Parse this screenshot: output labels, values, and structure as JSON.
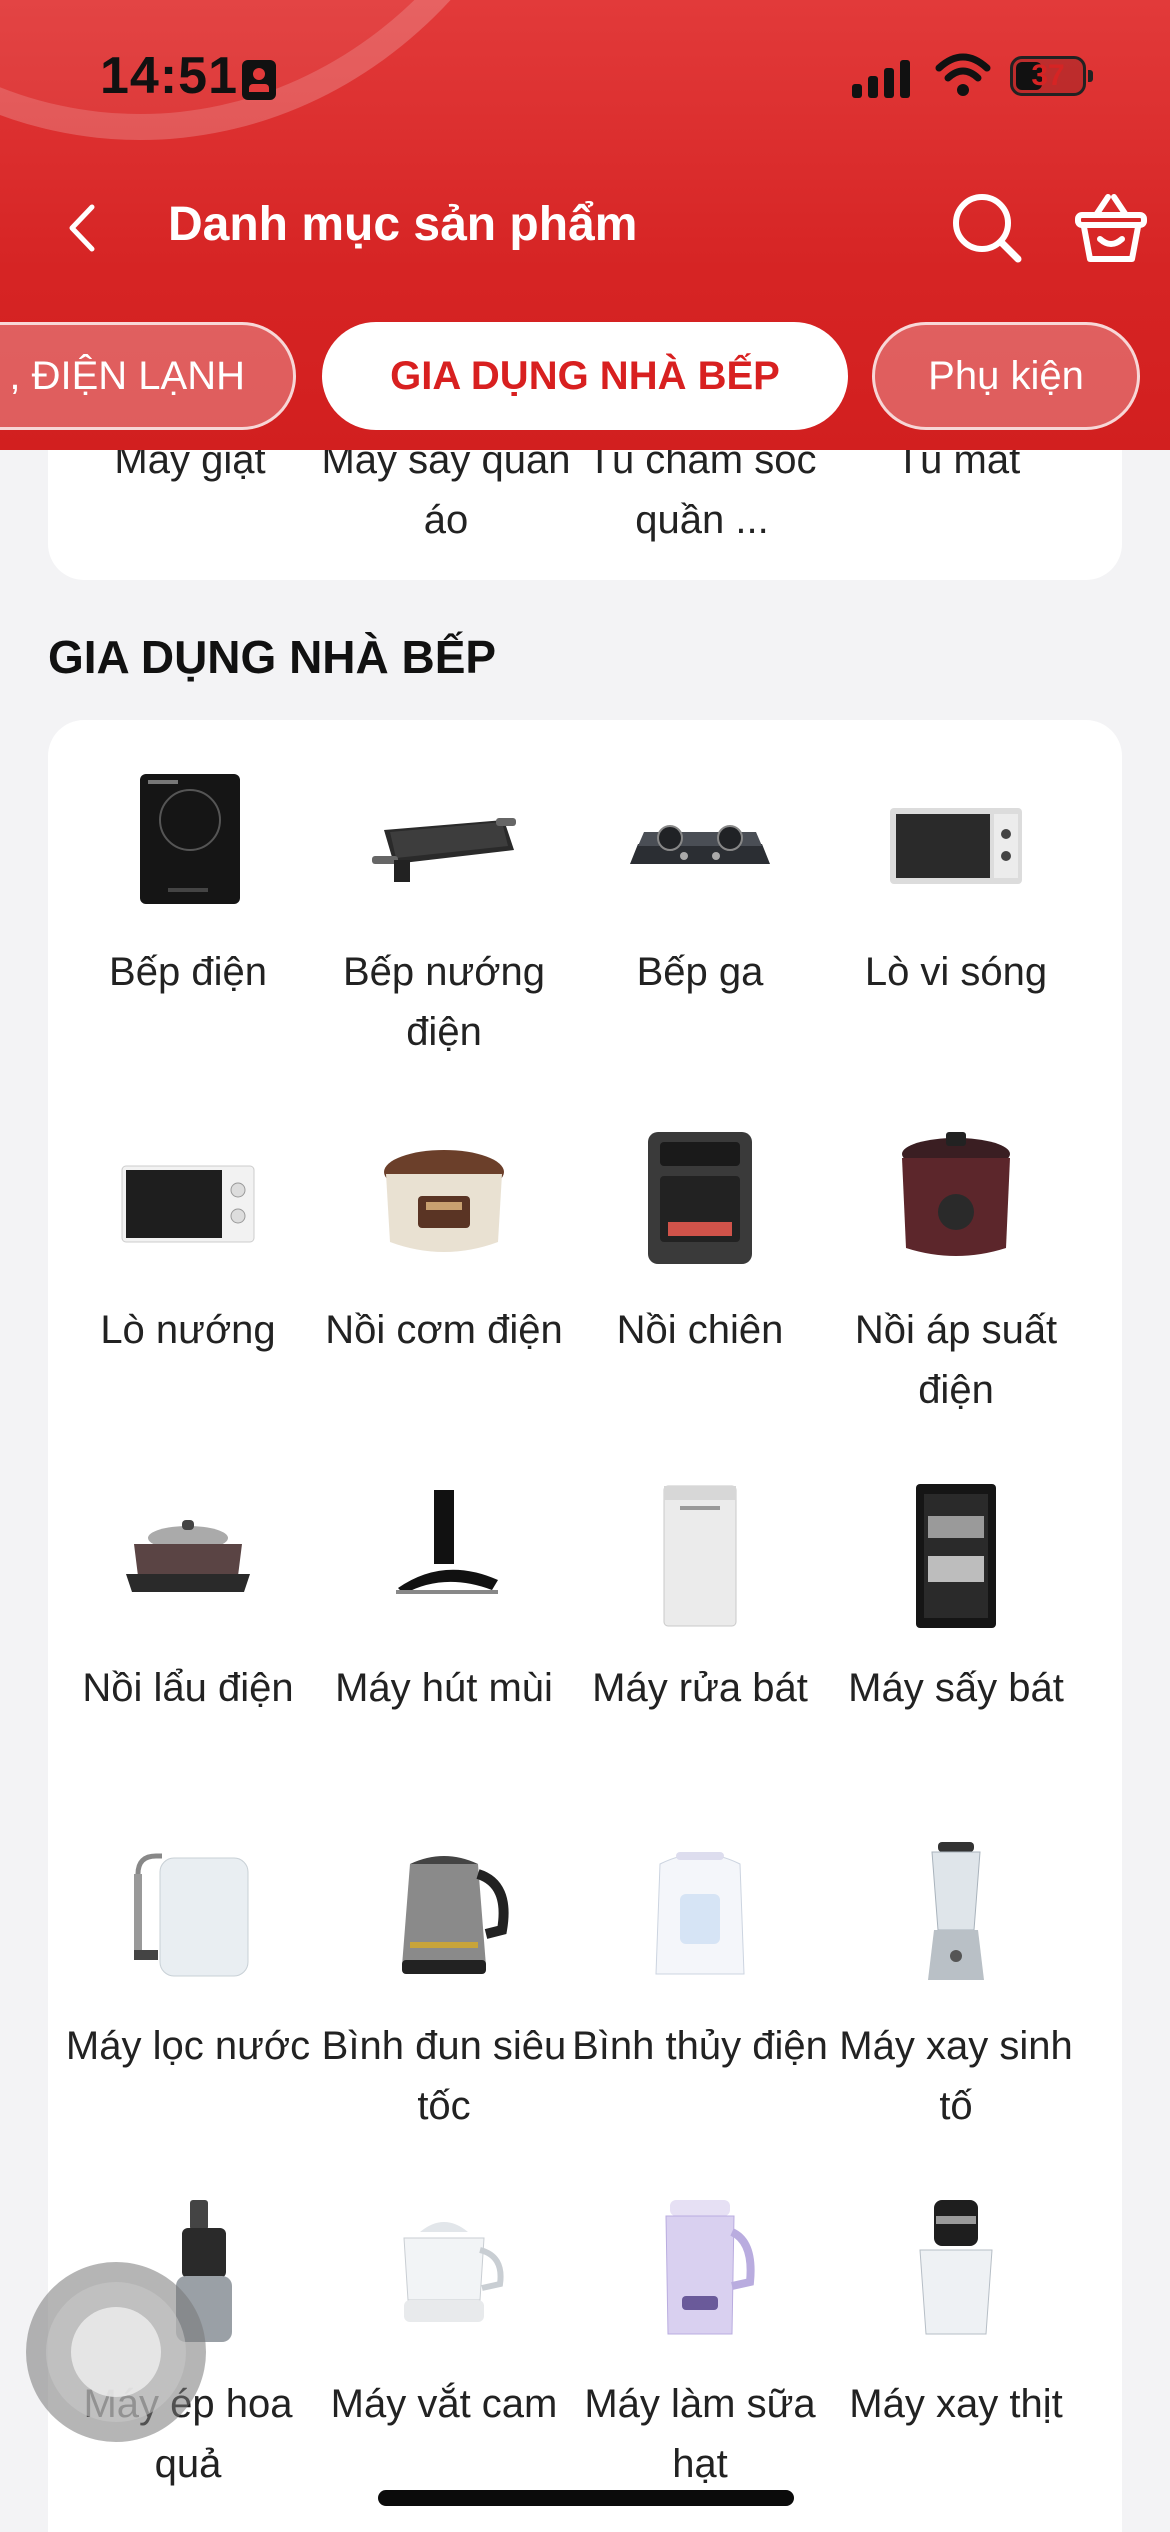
{
  "status_bar": {
    "time": "14:51",
    "battery": "37"
  },
  "header": {
    "title": "Danh mục sản phẩm",
    "back_icon": "chevron-left-icon",
    "search_icon": "search-icon",
    "cart_icon": "shopping-basket-icon"
  },
  "tabs": [
    {
      "label": ", ĐIỆN LẠNH",
      "active": false
    },
    {
      "label": "GIA DỤNG NHÀ BẾP",
      "active": true
    },
    {
      "label": "Phụ kiện",
      "active": false
    }
  ],
  "previous_section": {
    "items": [
      {
        "label": "Máy giặt"
      },
      {
        "label": "Máy sấy quần áo"
      },
      {
        "label": "Tủ chăm sóc quần ..."
      },
      {
        "label": "Tủ mát"
      }
    ]
  },
  "section": {
    "title": "GIA DỤNG NHÀ BẾP",
    "items": [
      {
        "label": "Bếp điện",
        "icon": "induction-cooktop-icon"
      },
      {
        "label": "Bếp nướng điện",
        "icon": "electric-grill-icon"
      },
      {
        "label": "Bếp ga",
        "icon": "gas-stove-icon"
      },
      {
        "label": "Lò vi sóng",
        "icon": "microwave-icon"
      },
      {
        "label": "Lò nướng",
        "icon": "oven-icon"
      },
      {
        "label": "Nồi cơm điện",
        "icon": "rice-cooker-icon"
      },
      {
        "label": "Nồi chiên",
        "icon": "air-fryer-icon"
      },
      {
        "label": "Nồi áp suất điện",
        "icon": "pressure-cooker-icon"
      },
      {
        "label": "Nồi lẩu điện",
        "icon": "hotpot-icon"
      },
      {
        "label": "Máy hút mùi",
        "icon": "range-hood-icon"
      },
      {
        "label": "Máy rửa bát",
        "icon": "dishwasher-icon"
      },
      {
        "label": "Máy sấy bát",
        "icon": "dish-dryer-icon"
      },
      {
        "label": "Máy lọc nước",
        "icon": "water-purifier-icon"
      },
      {
        "label": "Bình đun siêu tốc",
        "icon": "electric-kettle-icon"
      },
      {
        "label": "Bình thủy điện",
        "icon": "thermo-pot-icon"
      },
      {
        "label": "Máy xay sinh tố",
        "icon": "blender-icon"
      },
      {
        "label": "Máy ép hoa quả",
        "icon": "juicer-icon"
      },
      {
        "label": "Máy vắt cam",
        "icon": "citrus-press-icon"
      },
      {
        "label": "Máy làm sữa hạt",
        "icon": "soy-milk-maker-icon"
      },
      {
        "label": "Máy xay thịt",
        "icon": "meat-grinder-icon"
      }
    ]
  }
}
